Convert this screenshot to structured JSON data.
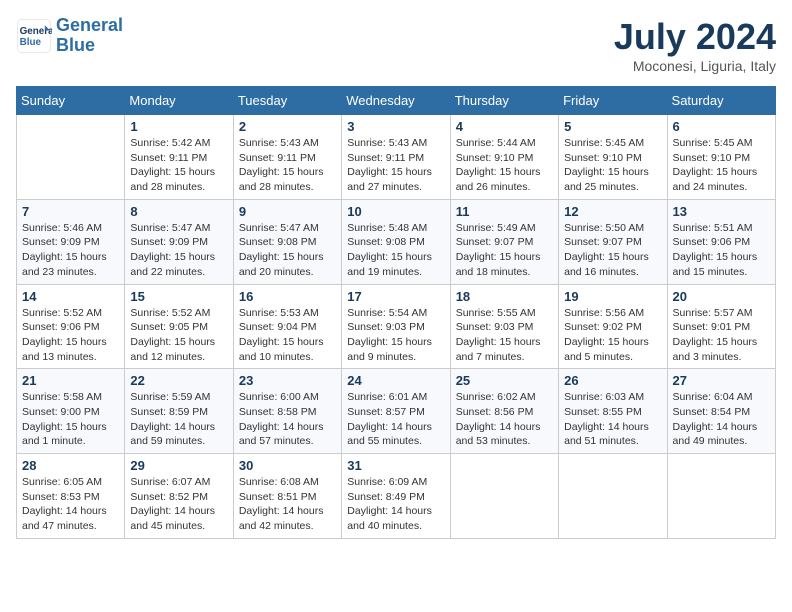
{
  "header": {
    "logo_line1": "General",
    "logo_line2": "Blue",
    "month": "July 2024",
    "location": "Moconesi, Liguria, Italy"
  },
  "columns": [
    "Sunday",
    "Monday",
    "Tuesday",
    "Wednesday",
    "Thursday",
    "Friday",
    "Saturday"
  ],
  "weeks": [
    [
      {
        "day": "",
        "info": ""
      },
      {
        "day": "1",
        "info": "Sunrise: 5:42 AM\nSunset: 9:11 PM\nDaylight: 15 hours\nand 28 minutes."
      },
      {
        "day": "2",
        "info": "Sunrise: 5:43 AM\nSunset: 9:11 PM\nDaylight: 15 hours\nand 28 minutes."
      },
      {
        "day": "3",
        "info": "Sunrise: 5:43 AM\nSunset: 9:11 PM\nDaylight: 15 hours\nand 27 minutes."
      },
      {
        "day": "4",
        "info": "Sunrise: 5:44 AM\nSunset: 9:10 PM\nDaylight: 15 hours\nand 26 minutes."
      },
      {
        "day": "5",
        "info": "Sunrise: 5:45 AM\nSunset: 9:10 PM\nDaylight: 15 hours\nand 25 minutes."
      },
      {
        "day": "6",
        "info": "Sunrise: 5:45 AM\nSunset: 9:10 PM\nDaylight: 15 hours\nand 24 minutes."
      }
    ],
    [
      {
        "day": "7",
        "info": "Sunrise: 5:46 AM\nSunset: 9:09 PM\nDaylight: 15 hours\nand 23 minutes."
      },
      {
        "day": "8",
        "info": "Sunrise: 5:47 AM\nSunset: 9:09 PM\nDaylight: 15 hours\nand 22 minutes."
      },
      {
        "day": "9",
        "info": "Sunrise: 5:47 AM\nSunset: 9:08 PM\nDaylight: 15 hours\nand 20 minutes."
      },
      {
        "day": "10",
        "info": "Sunrise: 5:48 AM\nSunset: 9:08 PM\nDaylight: 15 hours\nand 19 minutes."
      },
      {
        "day": "11",
        "info": "Sunrise: 5:49 AM\nSunset: 9:07 PM\nDaylight: 15 hours\nand 18 minutes."
      },
      {
        "day": "12",
        "info": "Sunrise: 5:50 AM\nSunset: 9:07 PM\nDaylight: 15 hours\nand 16 minutes."
      },
      {
        "day": "13",
        "info": "Sunrise: 5:51 AM\nSunset: 9:06 PM\nDaylight: 15 hours\nand 15 minutes."
      }
    ],
    [
      {
        "day": "14",
        "info": "Sunrise: 5:52 AM\nSunset: 9:06 PM\nDaylight: 15 hours\nand 13 minutes."
      },
      {
        "day": "15",
        "info": "Sunrise: 5:52 AM\nSunset: 9:05 PM\nDaylight: 15 hours\nand 12 minutes."
      },
      {
        "day": "16",
        "info": "Sunrise: 5:53 AM\nSunset: 9:04 PM\nDaylight: 15 hours\nand 10 minutes."
      },
      {
        "day": "17",
        "info": "Sunrise: 5:54 AM\nSunset: 9:03 PM\nDaylight: 15 hours\nand 9 minutes."
      },
      {
        "day": "18",
        "info": "Sunrise: 5:55 AM\nSunset: 9:03 PM\nDaylight: 15 hours\nand 7 minutes."
      },
      {
        "day": "19",
        "info": "Sunrise: 5:56 AM\nSunset: 9:02 PM\nDaylight: 15 hours\nand 5 minutes."
      },
      {
        "day": "20",
        "info": "Sunrise: 5:57 AM\nSunset: 9:01 PM\nDaylight: 15 hours\nand 3 minutes."
      }
    ],
    [
      {
        "day": "21",
        "info": "Sunrise: 5:58 AM\nSunset: 9:00 PM\nDaylight: 15 hours\nand 1 minute."
      },
      {
        "day": "22",
        "info": "Sunrise: 5:59 AM\nSunset: 8:59 PM\nDaylight: 14 hours\nand 59 minutes."
      },
      {
        "day": "23",
        "info": "Sunrise: 6:00 AM\nSunset: 8:58 PM\nDaylight: 14 hours\nand 57 minutes."
      },
      {
        "day": "24",
        "info": "Sunrise: 6:01 AM\nSunset: 8:57 PM\nDaylight: 14 hours\nand 55 minutes."
      },
      {
        "day": "25",
        "info": "Sunrise: 6:02 AM\nSunset: 8:56 PM\nDaylight: 14 hours\nand 53 minutes."
      },
      {
        "day": "26",
        "info": "Sunrise: 6:03 AM\nSunset: 8:55 PM\nDaylight: 14 hours\nand 51 minutes."
      },
      {
        "day": "27",
        "info": "Sunrise: 6:04 AM\nSunset: 8:54 PM\nDaylight: 14 hours\nand 49 minutes."
      }
    ],
    [
      {
        "day": "28",
        "info": "Sunrise: 6:05 AM\nSunset: 8:53 PM\nDaylight: 14 hours\nand 47 minutes."
      },
      {
        "day": "29",
        "info": "Sunrise: 6:07 AM\nSunset: 8:52 PM\nDaylight: 14 hours\nand 45 minutes."
      },
      {
        "day": "30",
        "info": "Sunrise: 6:08 AM\nSunset: 8:51 PM\nDaylight: 14 hours\nand 42 minutes."
      },
      {
        "day": "31",
        "info": "Sunrise: 6:09 AM\nSunset: 8:49 PM\nDaylight: 14 hours\nand 40 minutes."
      },
      {
        "day": "",
        "info": ""
      },
      {
        "day": "",
        "info": ""
      },
      {
        "day": "",
        "info": ""
      }
    ]
  ]
}
